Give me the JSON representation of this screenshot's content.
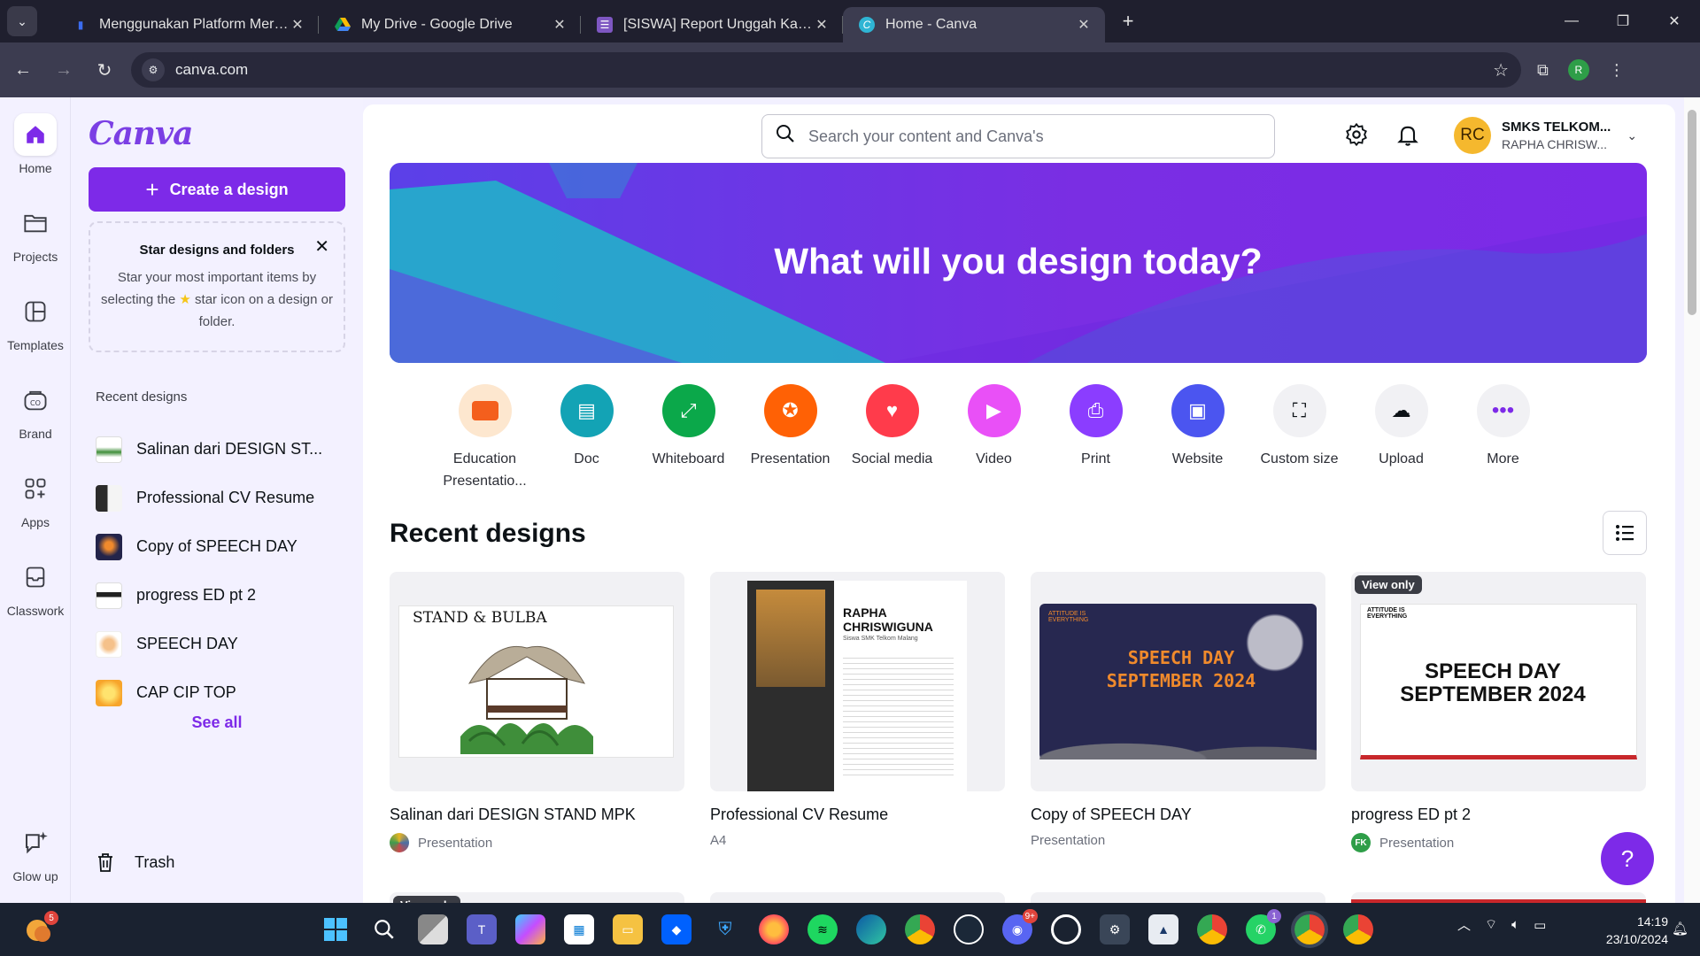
{
  "browser": {
    "tabs": [
      {
        "title": "Menggunakan Platform Merdeka",
        "active": false
      },
      {
        "title": "My Drive - Google Drive",
        "active": false
      },
      {
        "title": "[SISWA] Report Unggah Karya C",
        "active": false
      },
      {
        "title": "Home - Canva",
        "active": true
      }
    ],
    "url": "canva.com",
    "profile_initial": "R"
  },
  "rail": {
    "items": [
      {
        "label": "Home",
        "icon": "home-icon",
        "active": true
      },
      {
        "label": "Projects",
        "icon": "folder-icon"
      },
      {
        "label": "Templates",
        "icon": "templates-icon"
      },
      {
        "label": "Brand",
        "icon": "brand-icon"
      },
      {
        "label": "Apps",
        "icon": "apps-icon"
      },
      {
        "label": "Classwork",
        "icon": "classwork-icon"
      }
    ],
    "glow_up": "Glow up"
  },
  "sidebar": {
    "logo": "Canva",
    "create_button": "Create a design",
    "star_card": {
      "title": "Star designs and folders",
      "body_before": "Star your most important items by selecting the",
      "body_after": "star icon on a design or folder."
    },
    "recent_heading": "Recent designs",
    "recent": [
      {
        "name": "Salinan dari DESIGN ST..."
      },
      {
        "name": "Professional CV Resume"
      },
      {
        "name": "Copy of SPEECH DAY"
      },
      {
        "name": "progress ED pt 2"
      },
      {
        "name": "SPEECH DAY"
      },
      {
        "name": "CAP CIP TOP"
      }
    ],
    "see_all": "See all",
    "trash": "Trash"
  },
  "header": {
    "search_placeholder": "Search your content and Canva's",
    "account_name": "SMKS TELKOM...",
    "account_user": "RAPHA CHRISW...",
    "avatar": "RC"
  },
  "hero": {
    "title": "What will you design today?"
  },
  "shortcuts": [
    {
      "label": "Education Presentatio...",
      "icon": "education-presentation-icon",
      "color": "#fbe3c9"
    },
    {
      "label": "Doc",
      "icon": "doc-icon",
      "color": "#13a3b5"
    },
    {
      "label": "Whiteboard",
      "icon": "whiteboard-icon",
      "color": "#0ba84a"
    },
    {
      "label": "Presentation",
      "icon": "presentation-icon",
      "color": "#ff6105"
    },
    {
      "label": "Social media",
      "icon": "social-media-icon",
      "color": "#ff3b4b"
    },
    {
      "label": "Video",
      "icon": "video-icon",
      "color": "#e950f7"
    },
    {
      "label": "Print",
      "icon": "print-icon",
      "color": "#8b3dff"
    },
    {
      "label": "Website",
      "icon": "website-icon",
      "color": "#4b55f0"
    },
    {
      "label": "Custom size",
      "icon": "custom-size-icon",
      "color": "#f1f1f4"
    },
    {
      "label": "Upload",
      "icon": "upload-icon",
      "color": "#f1f1f4"
    },
    {
      "label": "More",
      "icon": "more-icon",
      "color": "#f1f1f4"
    }
  ],
  "recent_section": {
    "title": "Recent designs",
    "designs": [
      {
        "title": "Salinan dari DESIGN STAND MPK",
        "type": "Presentation",
        "view_only": false,
        "preview_text": "STAND & BULBA"
      },
      {
        "title": "Professional CV Resume",
        "type": "A4",
        "view_only": false,
        "preview_text": "RAPHA CHRISWIGUNA"
      },
      {
        "title": "Copy of SPEECH DAY",
        "type": "Presentation",
        "view_only": false,
        "preview_text": "SPEECH DAY SEPTEMBER 2024"
      },
      {
        "title": "progress ED pt 2",
        "type": "Presentation",
        "view_only": true,
        "preview_text": "SPEECH DAY SEPTEMBER 2024",
        "owner": "FK"
      }
    ],
    "view_only_label": "View only",
    "cv_subtitle": "Siswa SMK Telkom Malang",
    "attitude_text": "ATTITUDE IS EVERYTHING"
  },
  "taskbar": {
    "time": "14:19",
    "date": "23/10/2024",
    "weather_badge": "5",
    "discord_badge": "9+",
    "whatsapp_badge": "1"
  }
}
